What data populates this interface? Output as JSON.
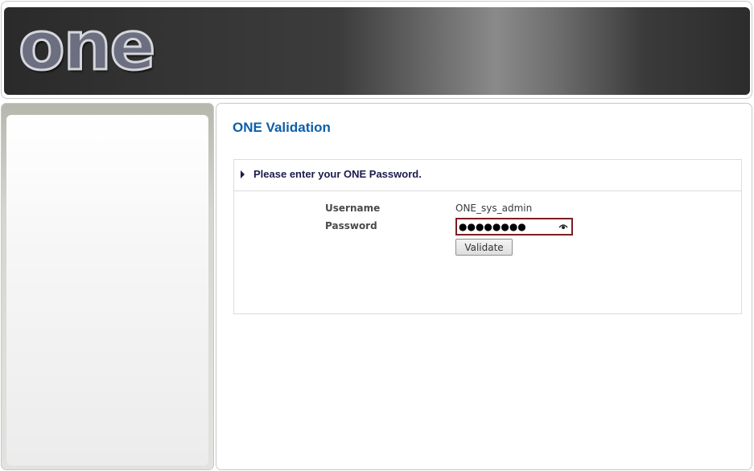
{
  "header": {
    "logo_text": "one"
  },
  "content": {
    "title": "ONE Validation",
    "prompt": "Please enter your ONE Password.",
    "form": {
      "username_label": "Username",
      "username_value": "ONE_sys_admin",
      "password_label": "Password",
      "password_masked": "●●●●●●●●",
      "validate_button": "Validate"
    }
  },
  "icons": {
    "caret": "caret-right-icon",
    "password_reveal": "eye-icon"
  },
  "colors": {
    "title": "#0e5ea8",
    "prompt": "#1b1b4e",
    "password_border": "#7a1f24"
  }
}
